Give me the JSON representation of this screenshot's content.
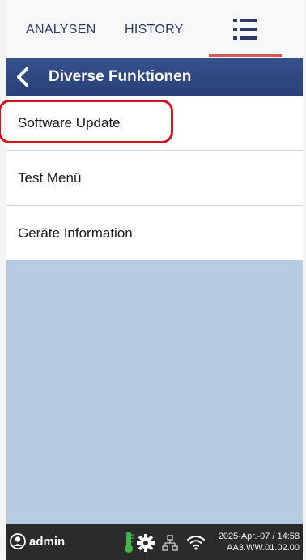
{
  "tabs": [
    {
      "label": "ANALYSEN"
    },
    {
      "label": "HISTORY"
    }
  ],
  "menu_tab": {
    "icon": "menu-list-icon",
    "active": true,
    "accent": "#d9574f"
  },
  "header": {
    "title": "Diverse Funktionen",
    "back_icon": "chevron-left-icon",
    "color": "#2f4a84"
  },
  "list": {
    "items": [
      {
        "label": "Software Update",
        "highlighted": true
      },
      {
        "label": "Test Menü"
      },
      {
        "label": "Geräte Information"
      }
    ],
    "highlight_color": "#d1151f"
  },
  "empty_area_color": "#b5cce3",
  "status": {
    "user": "admin",
    "user_icon": "user-icon",
    "icons": [
      "thermometer-icon",
      "gear-icon",
      "network-icon",
      "wifi-icon"
    ],
    "date": "2025-Apr.-07 / 14:58",
    "version": "AA3.WW.01.02.00"
  }
}
